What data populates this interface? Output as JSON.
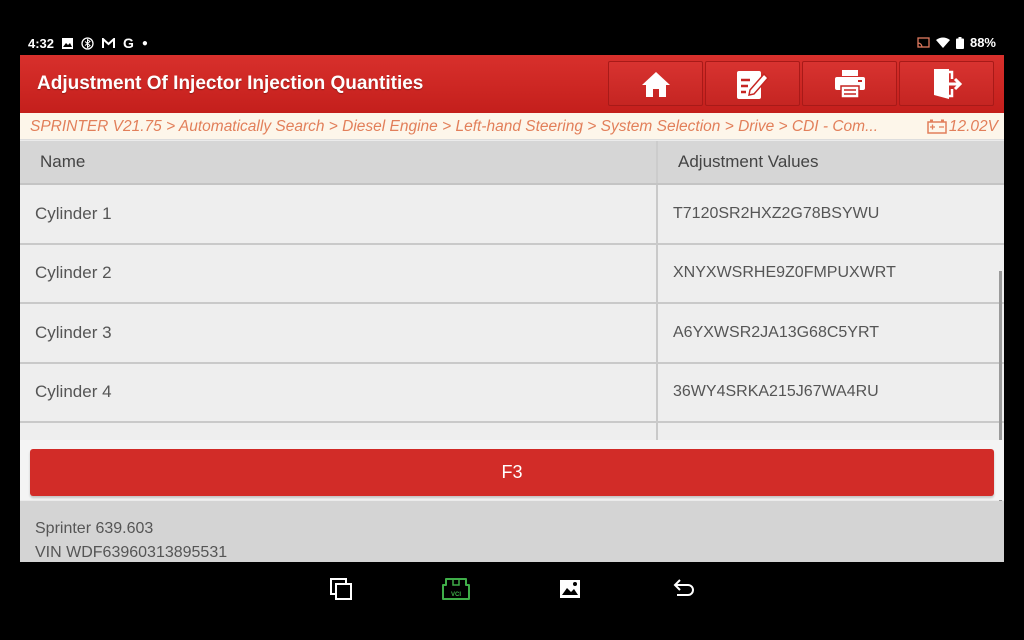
{
  "status_bar": {
    "time": "4:32",
    "left_icons": [
      "image-notification-icon",
      "bluetooth-icon",
      "gmail-icon",
      "google-icon",
      "dot-icon"
    ],
    "right_icons": [
      "cast-icon",
      "wifi-icon",
      "battery-icon"
    ],
    "battery": "88%"
  },
  "header": {
    "title": "Adjustment Of Injector Injection Quantities",
    "buttons": [
      {
        "name": "home-button",
        "icon": "home-icon"
      },
      {
        "name": "report-button",
        "icon": "edit-report-icon"
      },
      {
        "name": "print-button",
        "icon": "print-icon"
      },
      {
        "name": "exit-button",
        "icon": "exit-icon"
      }
    ],
    "accent_color": "#d32f2c"
  },
  "breadcrumb": {
    "path": "SPRINTER V21.75 > Automatically Search > Diesel Engine > Left-hand Steering > System Selection > Drive > CDI -  Com...",
    "voltage": "12.02V"
  },
  "table": {
    "columns": [
      "Name",
      "Adjustment Values"
    ],
    "rows": [
      {
        "name": "Cylinder  1",
        "value": "T7120SR2HXZ2G78BSYWU"
      },
      {
        "name": "Cylinder  2",
        "value": "XNYXWSRHE9Z0FMPUXWRT"
      },
      {
        "name": "Cylinder  3",
        "value": "A6YXWSR2JA13G68C5YRT"
      },
      {
        "name": "Cylinder  4",
        "value": "36WY4SRKA215J67WA4RU"
      }
    ]
  },
  "actions": {
    "f3_label": "F3"
  },
  "footer": {
    "model": "Sprinter 639.603",
    "vin": "VIN WDF63960313895531"
  },
  "nav_bar": {
    "items": [
      "recent-apps-icon",
      "vci-icon",
      "screenshot-icon",
      "back-icon"
    ],
    "vci_color": "#3fae49"
  }
}
